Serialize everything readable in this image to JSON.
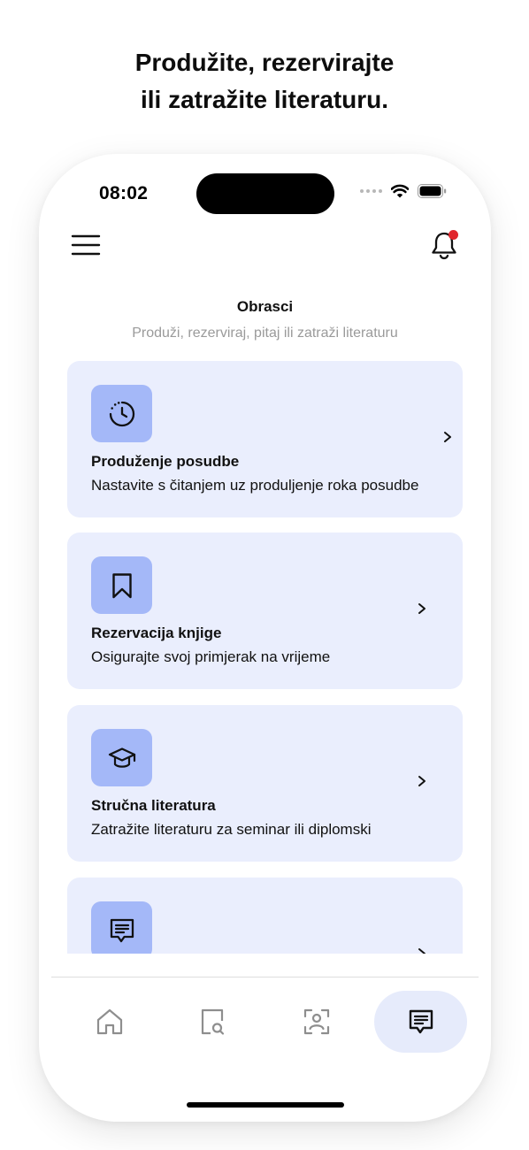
{
  "headline": {
    "line1": "Produžite, rezervirajte",
    "line2": "ili zatražite literaturu."
  },
  "status_bar": {
    "time": "08:02",
    "icons": [
      "cellular-signal-icon",
      "wifi-icon",
      "battery-icon"
    ]
  },
  "top_bar": {
    "menu_icon": "hamburger-menu-icon",
    "notification_icon": "bell-icon",
    "notification_badge_color": "#e0262d"
  },
  "page": {
    "title": "Obrasci",
    "subtitle": "Produži, rezerviraj, pitaj ili zatraži literaturu"
  },
  "forms": [
    {
      "icon": "timer-icon",
      "title": "Produženje posudbe",
      "description": "Nastavite s čitanjem uz produljenje roka posudbe"
    },
    {
      "icon": "bookmark-icon",
      "title": "Rezervacija knjige",
      "description": "Osigurajte svoj primjerak na vrijeme"
    },
    {
      "icon": "graduation-cap-icon",
      "title": "Stručna literatura",
      "description": "Zatražite literaturu za seminar ili diplomski"
    },
    {
      "icon": "message-icon",
      "title": "",
      "description": ""
    }
  ],
  "tab_bar": {
    "tabs": [
      {
        "icon": "home-icon",
        "active": false
      },
      {
        "icon": "document-search-icon",
        "active": false
      },
      {
        "icon": "face-scan-icon",
        "active": false
      },
      {
        "icon": "message-icon",
        "active": true
      }
    ]
  },
  "colors": {
    "card_background": "#eaeefd",
    "icon_tile": "#a4b8f8",
    "active_tab_background": "#e6ebfb",
    "subtitle_text": "#9a9a9a"
  }
}
